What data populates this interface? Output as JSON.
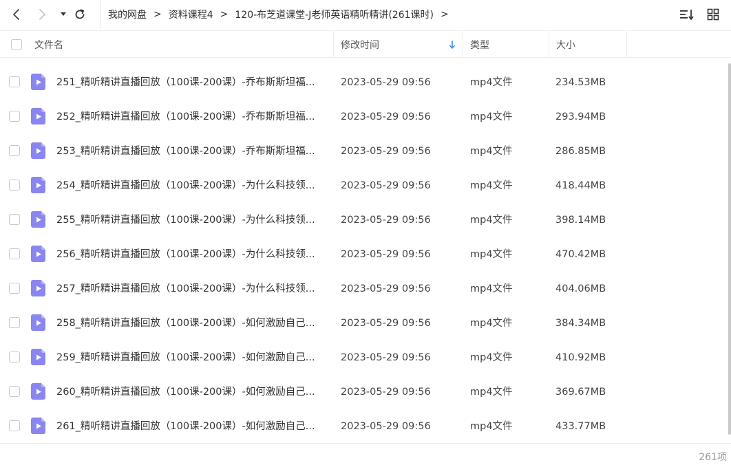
{
  "breadcrumb": [
    {
      "label": "我的网盘"
    },
    {
      "label": "资料课程4"
    },
    {
      "label": "120-布芝道课堂-J老师英语精听精讲(261课时)"
    }
  ],
  "separator": ">",
  "columns": {
    "name": "文件名",
    "modified": "修改时间",
    "type": "类型",
    "size": "大小"
  },
  "colors": {
    "accent": "#3a8ee6",
    "file_icon": "#8a86f0"
  },
  "files": [
    {
      "name": "251_精听精讲直播回放（100课-200课）-乔布斯斯坦福...",
      "modified": "2023-05-29 09:56",
      "type": "mp4文件",
      "size": "234.53MB"
    },
    {
      "name": "252_精听精讲直播回放（100课-200课）-乔布斯斯坦福...",
      "modified": "2023-05-29 09:56",
      "type": "mp4文件",
      "size": "293.94MB"
    },
    {
      "name": "253_精听精讲直播回放（100课-200课）-乔布斯斯坦福...",
      "modified": "2023-05-29 09:56",
      "type": "mp4文件",
      "size": "286.85MB"
    },
    {
      "name": "254_精听精讲直播回放（100课-200课）-为什么科技领...",
      "modified": "2023-05-29 09:56",
      "type": "mp4文件",
      "size": "418.44MB"
    },
    {
      "name": "255_精听精讲直播回放（100课-200课）-为什么科技领...",
      "modified": "2023-05-29 09:56",
      "type": "mp4文件",
      "size": "398.14MB"
    },
    {
      "name": "256_精听精讲直播回放（100课-200课）-为什么科技领...",
      "modified": "2023-05-29 09:56",
      "type": "mp4文件",
      "size": "470.42MB"
    },
    {
      "name": "257_精听精讲直播回放（100课-200课）-为什么科技领...",
      "modified": "2023-05-29 09:56",
      "type": "mp4文件",
      "size": "404.06MB"
    },
    {
      "name": "258_精听精讲直播回放（100课-200课）-如何激励自己...",
      "modified": "2023-05-29 09:56",
      "type": "mp4文件",
      "size": "384.34MB"
    },
    {
      "name": "259_精听精讲直播回放（100课-200课）-如何激励自己...",
      "modified": "2023-05-29 09:56",
      "type": "mp4文件",
      "size": "410.92MB"
    },
    {
      "name": "260_精听精讲直播回放（100课-200课）-如何激励自己...",
      "modified": "2023-05-29 09:56",
      "type": "mp4文件",
      "size": "369.67MB"
    },
    {
      "name": "261_精听精讲直播回放（100课-200课）-如何激励自己...",
      "modified": "2023-05-29 09:56",
      "type": "mp4文件",
      "size": "433.77MB"
    }
  ],
  "footer": {
    "count": "261项"
  }
}
